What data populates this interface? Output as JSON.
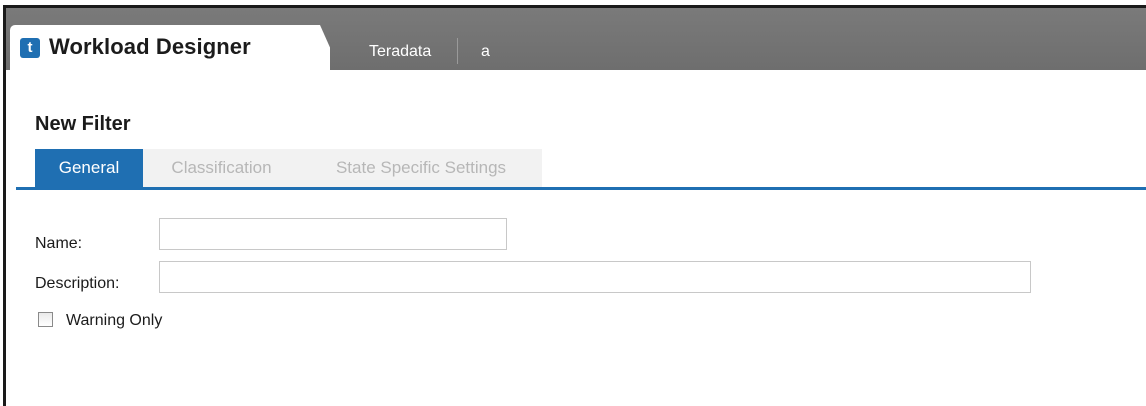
{
  "header": {
    "app_icon_glyph": "t",
    "app_title": "Workload Designer",
    "breadcrumbs": [
      "Teradata",
      "a"
    ]
  },
  "page": {
    "title": "New Filter"
  },
  "tabs": [
    {
      "label": "General",
      "active": true
    },
    {
      "label": "Classification",
      "active": false
    },
    {
      "label": "State Specific Settings",
      "active": false
    }
  ],
  "form": {
    "name_label": "Name:",
    "name_value": "",
    "description_label": "Description:",
    "description_value": "",
    "warning_only_label": "Warning Only",
    "warning_only_checked": false
  },
  "colors": {
    "accent": "#1f6fb2",
    "topbar": "#737373"
  }
}
